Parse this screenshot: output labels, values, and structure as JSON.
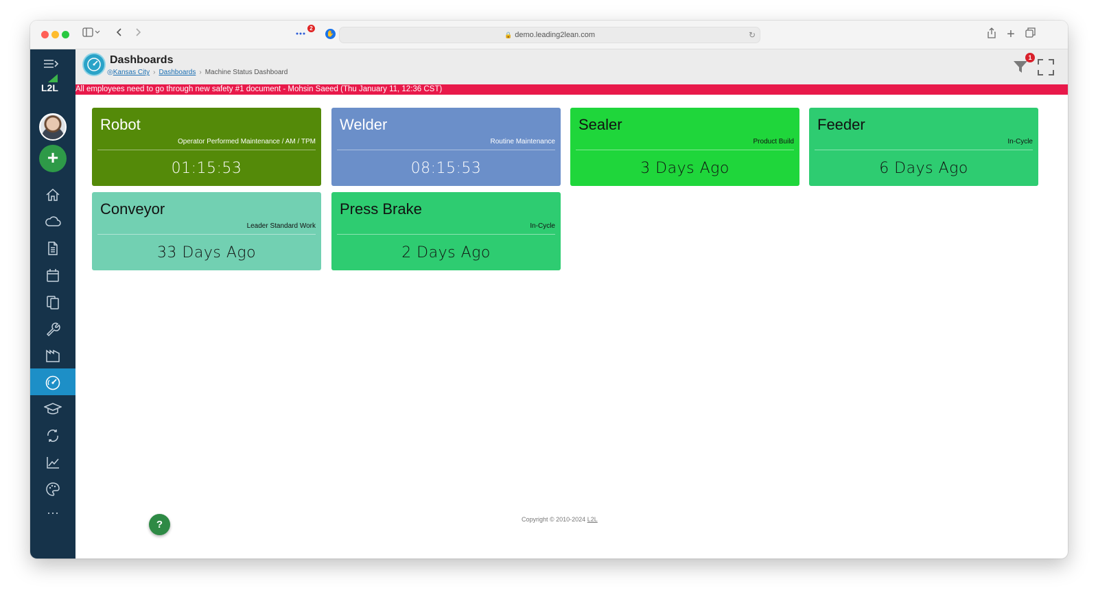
{
  "browser": {
    "url": "demo.leading2lean.com",
    "extension_badge": "2"
  },
  "sidebar": {
    "logo_text": "L2L",
    "add_label": "+",
    "items": [
      {
        "icon": "home-icon"
      },
      {
        "icon": "cloud-icon"
      },
      {
        "icon": "document-icon"
      },
      {
        "icon": "calendar-icon"
      },
      {
        "icon": "clipboard-icon"
      },
      {
        "icon": "wrench-icon"
      },
      {
        "icon": "factory-icon"
      },
      {
        "icon": "dashboard-icon",
        "active": true
      },
      {
        "icon": "graduation-cap-icon"
      },
      {
        "icon": "cycle-icon"
      },
      {
        "icon": "line-chart-icon"
      },
      {
        "icon": "palette-icon"
      },
      {
        "icon": "more-icon"
      }
    ],
    "more_label": "···"
  },
  "header": {
    "title": "Dashboards",
    "breadcrumb": {
      "site": "Kansas City",
      "section": "Dashboards",
      "current": "Machine Status Dashboard"
    },
    "filter_badge": "1"
  },
  "announcement": "All employees need to go through new safety #1 document - Mohsin Saeed (Thu January 11, 12:36 CST)",
  "tiles": [
    {
      "name": "Robot",
      "status": "Operator Performed Maintenance / AM / TPM",
      "time": "01:15:53",
      "color": "#548a09"
    },
    {
      "name": "Welder",
      "status": "Routine Maintenance",
      "time": "08:15:53",
      "color": "#6b8fc9"
    },
    {
      "name": "Sealer",
      "status": "Product Build",
      "time": "3 Days Ago",
      "color": "#1fd63b"
    },
    {
      "name": "Feeder",
      "status": "In-Cycle",
      "time": "6 Days Ago",
      "color": "#2ecc71"
    },
    {
      "name": "Conveyor",
      "status": "Leader Standard Work",
      "time": "33 Days Ago",
      "color": "#72d0b2"
    },
    {
      "name": "Press Brake",
      "status": "In-Cycle",
      "time": "2 Days Ago",
      "color": "#2ecc71"
    }
  ],
  "footer": {
    "copyright": "Copyright © 2010-2024",
    "brand": "L2L"
  },
  "help_label": "?"
}
